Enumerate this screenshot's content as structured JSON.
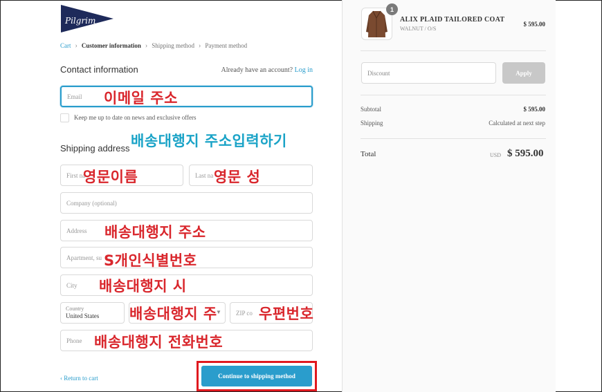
{
  "breadcrumb": {
    "cart": "Cart",
    "customer_information": "Customer information",
    "shipping_method": "Shipping method",
    "payment_method": "Payment method"
  },
  "contact": {
    "heading": "Contact information",
    "login_prompt": "Already have an account?",
    "login_link": "Log in",
    "email_placeholder": "Email",
    "newsletter_label": "Keep me up to date on news and exclusive offers"
  },
  "shipping": {
    "heading": "Shipping address",
    "first_name_placeholder": "First na",
    "last_name_placeholder": "Last na",
    "company_placeholder": "Company (optional)",
    "address_placeholder": "Address",
    "apartment_placeholder": "Apartment, su",
    "city_placeholder": "City",
    "country_label": "Country",
    "country_value": "United States",
    "zip_placeholder": "ZIP co",
    "phone_placeholder": "Phone"
  },
  "annotations": {
    "email": "이메일 주소",
    "address_input": "배송대행지 주소입력하기",
    "first_name": "영문이름",
    "last_name": "영문 성",
    "address": "배송대행지 주소",
    "personal_id": "S개인식별번호",
    "city": "배송대행지 시",
    "state": "배송대행지 주",
    "zip": "우편번호",
    "phone": "배송대행지 전화번호"
  },
  "footer": {
    "back_link": "Return to cart",
    "continue_button": "Continue to shipping method"
  },
  "order": {
    "item_count": "1",
    "product_name": "ALIX PLAID TAILORED COAT",
    "product_variant": "WALNUT / O/S",
    "product_price": "$ 595.00",
    "discount_placeholder": "Discount",
    "apply_button": "Apply",
    "subtotal_label": "Subtotal",
    "subtotal_value": "$ 595.00",
    "shipping_label": "Shipping",
    "shipping_value": "Calculated at next step",
    "total_label": "Total",
    "total_currency": "USD",
    "total_value": "$ 595.00"
  },
  "colors": {
    "accent": "#2a9dcc",
    "annotation_red": "#d9262c",
    "annotation_blue": "#1aa3c7",
    "highlight_border": "#e0191f"
  },
  "icons": {
    "logo": "pilgrim-pennant-logo",
    "breadcrumb_separator": "chevron-right-icon",
    "back": "chevron-left-icon",
    "select": "chevron-down-icon"
  }
}
